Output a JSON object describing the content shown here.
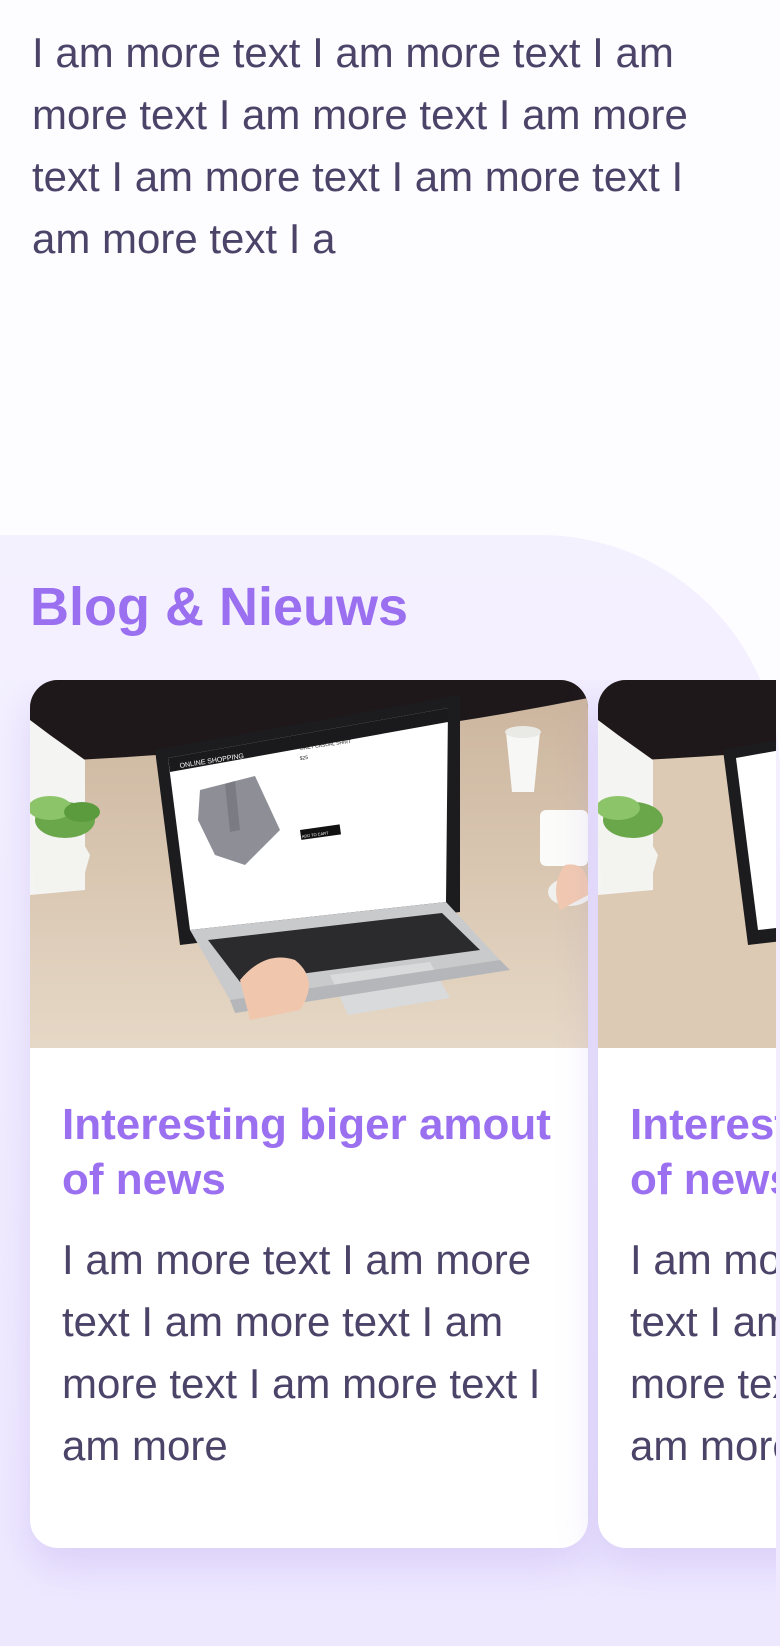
{
  "intro": {
    "text": "I am more text I am more text I am more text I am more text I am more text I am more text I am more text I am more text I a"
  },
  "blog": {
    "heading": "Blog & Nieuws",
    "cards": [
      {
        "title": "Interesting biger amout of news",
        "text": "I am more text I am more text I am more text I am more text I am more text I am more",
        "image": {
          "screen_header": "ONLINE SHOPPING",
          "product_title": "GREY CASUAL SHIRT",
          "price": "$25",
          "button_label": "ADD TO CART"
        }
      },
      {
        "title": "Interesting biger amout of news",
        "text": "I am more text I am more text I am more text I am more text I am more text I am more"
      }
    ]
  },
  "colors": {
    "accent": "#9a6ff0",
    "body_text": "#4b4468",
    "section_bg": "#f4f1ff"
  }
}
